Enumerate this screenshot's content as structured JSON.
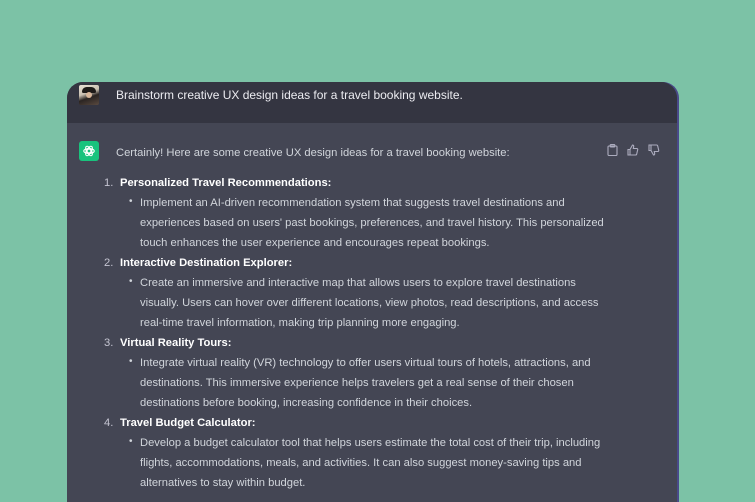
{
  "user_prompt": "Brainstorm creative UX design ideas for a travel booking website.",
  "assistant": {
    "intro": "Certainly! Here are some creative UX design ideas for a travel booking website:",
    "items": [
      {
        "number": "1.",
        "title": "Personalized Travel Recommendations:",
        "bullet": "Implement an AI-driven recommendation system that suggests travel destinations and experiences based on users' past bookings, preferences, and travel history. This personalized touch enhances the user experience and encourages repeat bookings."
      },
      {
        "number": "2.",
        "title": "Interactive Destination Explorer:",
        "bullet": "Create an immersive and interactive map that allows users to explore travel destinations visually. Users can hover over different locations, view photos, read descriptions, and access real-time travel information, making trip planning more engaging."
      },
      {
        "number": "3.",
        "title": "Virtual Reality Tours:",
        "bullet": "Integrate virtual reality (VR) technology to offer users virtual tours of hotels, attractions, and destinations. This immersive experience helps travelers get a real sense of their chosen destinations before booking, increasing confidence in their choices."
      },
      {
        "number": "4.",
        "title": "Travel Budget Calculator:",
        "bullet": "Develop a budget calculator tool that helps users estimate the total cost of their trip, including flights, accommodations, meals, and activities. It can also suggest money-saving tips and alternatives to stay within budget."
      }
    ]
  },
  "icons": {
    "copy": "clipboard-icon",
    "like": "thumbs-up-icon",
    "dislike": "thumbs-down-icon",
    "logo": "openai-logo-icon"
  },
  "colors": {
    "background": "#7cc2a6",
    "user_row": "#343541",
    "assistant_row": "#444654",
    "logo": "#19c37d"
  }
}
